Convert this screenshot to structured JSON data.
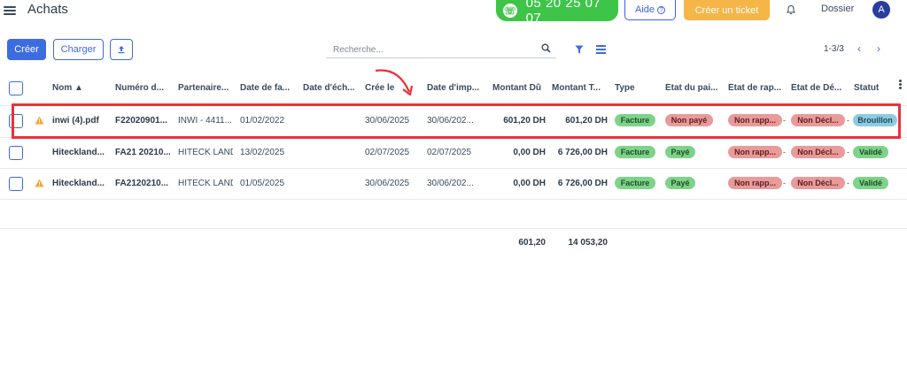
{
  "topbar": {
    "title": "Achats",
    "phone": "05 20 25 07 07",
    "help_label": "Aide",
    "ticket_label": "Créer un ticket",
    "dossier_label": "Dossier",
    "avatar_initial": "A"
  },
  "toolbar": {
    "create_label": "Créer",
    "upload_label": "Charger",
    "search_placeholder": "Recherche...",
    "pager_text": "1-3/3",
    "pager_prev": "‹",
    "pager_next": "›"
  },
  "table": {
    "columns": [
      "Nom ▲",
      "Numéro d...",
      "Partenaire...",
      "Date de fa...",
      "Date d'éch...",
      "Crée le",
      "Date d'imp...",
      "Montant Dû",
      "Montant T...",
      "Type",
      "État du pai...",
      "État de rap...",
      "État de Dé...",
      "Statut"
    ],
    "rows": [
      {
        "warning": true,
        "nom": "inwi (4).pdf",
        "numero": "F22020901...",
        "partenaire": "INWI - 4411...",
        "date_facture": "01/02/2022",
        "date_echeance": "",
        "cree_le": "30/06/2025",
        "date_import": "30/06/202...",
        "montant_du": "601,20 DH",
        "montant_total": "601,20 DH",
        "type": "Facture",
        "etat_paiement": "Non payé",
        "etat_rapprochement": "Non rapp...",
        "etat_declaration": "Non Décl...",
        "statut": "Brouillon",
        "sep": "-"
      },
      {
        "warning": false,
        "nom": "Hiteckland...",
        "numero": "FA21 20210...",
        "partenaire": "HITECK LAND",
        "date_facture": "13/02/2025",
        "date_echeance": "",
        "cree_le": "02/07/2025",
        "date_import": "02/07/2025",
        "montant_du": "0,00 DH",
        "montant_total": "6 726,00 DH",
        "type": "Facture",
        "etat_paiement": "Payé",
        "etat_rapprochement": "Non rapp...",
        "etat_declaration": "Non Décl...",
        "statut": "Validé",
        "sep": "-"
      },
      {
        "warning": true,
        "nom": "Hiteckland...",
        "numero": "FA2120210...",
        "partenaire": "HITECK LAND",
        "date_facture": "01/05/2025",
        "date_echeance": "",
        "cree_le": "30/06/2025",
        "date_import": "30/06/202...",
        "montant_du": "0,00 DH",
        "montant_total": "6 726,00 DH",
        "type": "Facture",
        "etat_paiement": "Payé",
        "etat_rapprochement": "Non rapp...",
        "etat_declaration": "Non Décl...",
        "statut": "Validé",
        "sep": "-"
      }
    ],
    "totals": {
      "montant_du": "601,20",
      "montant_total": "14 053,20"
    }
  },
  "colors": {
    "primary": "#3d6be0",
    "phone_green": "#3fc44a",
    "ticket_orange": "#f5b547",
    "annotation_red": "#e8313a",
    "badge_green": "#7ed38a",
    "badge_red": "#e99a9a",
    "badge_blue": "#8ecbe0"
  },
  "icons": [
    "menu-icon",
    "headset-icon",
    "help-icon",
    "bell-icon",
    "upload-icon",
    "search-icon",
    "filter-icon",
    "list-view-icon",
    "warning-icon",
    "sort-asc-icon",
    "more-vertical-icon"
  ]
}
